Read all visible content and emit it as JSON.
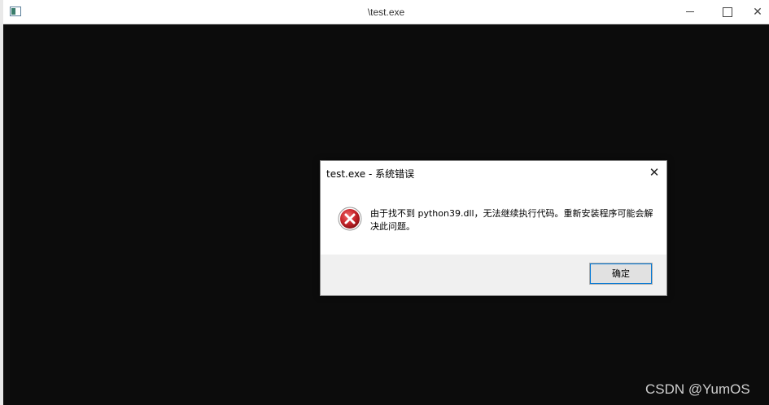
{
  "console": {
    "title": "\\test.exe",
    "minimize_icon": "minimize-icon",
    "maximize_icon": "maximize-icon",
    "close_glyph": "✕"
  },
  "dialog": {
    "title": "test.exe - 系统错误",
    "close_glyph": "✕",
    "icon": "error-icon",
    "message": "由于找不到 python39.dll，无法继续执行代码。重新安装程序可能会解决此问题。",
    "ok_label": "确定"
  },
  "watermark": {
    "text": "CSDN @YumOS"
  },
  "colors": {
    "console_bg": "#0c0c0c",
    "error_red": "#c8262c",
    "focus_blue": "#0078d7"
  }
}
